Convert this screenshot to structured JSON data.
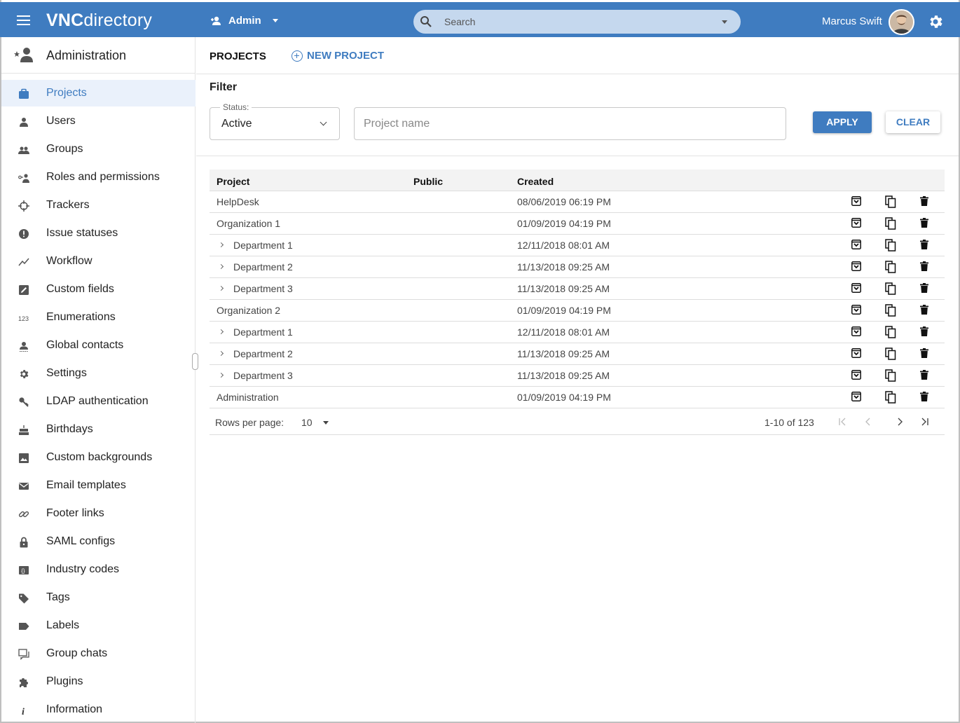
{
  "topbar": {
    "logo_bold": "VNC",
    "logo_rest": "directory",
    "mode_label": "Admin",
    "search_placeholder": "Search",
    "user_name": "Marcus Swift",
    "accent": "#3f7cc0"
  },
  "sidebar": {
    "title": "Administration",
    "items": [
      {
        "label": "Projects",
        "icon": "briefcase-icon",
        "active": true
      },
      {
        "label": "Users",
        "icon": "person-icon"
      },
      {
        "label": "Groups",
        "icon": "people-icon"
      },
      {
        "label": "Roles and permissions",
        "icon": "key-person-icon"
      },
      {
        "label": "Trackers",
        "icon": "crosshair-icon"
      },
      {
        "label": "Issue statuses",
        "icon": "alert-circle-icon"
      },
      {
        "label": "Workflow",
        "icon": "trend-line-icon"
      },
      {
        "label": "Custom fields",
        "icon": "edit-square-icon"
      },
      {
        "label": "Enumerations",
        "icon": "numbers-icon"
      },
      {
        "label": "Global contacts",
        "icon": "contact-icon"
      },
      {
        "label": "Settings",
        "icon": "gear-icon"
      },
      {
        "label": "LDAP authentication",
        "icon": "key-icon"
      },
      {
        "label": "Birthdays",
        "icon": "cake-icon"
      },
      {
        "label": "Custom backgrounds",
        "icon": "image-icon"
      },
      {
        "label": "Email templates",
        "icon": "mail-icon"
      },
      {
        "label": "Footer links",
        "icon": "link-icon"
      },
      {
        "label": "SAML configs",
        "icon": "lock-icon"
      },
      {
        "label": "Industry codes",
        "icon": "code-box-icon"
      },
      {
        "label": "Tags",
        "icon": "tag-icon"
      },
      {
        "label": "Labels",
        "icon": "label-icon"
      },
      {
        "label": "Group chats",
        "icon": "chat-icon"
      },
      {
        "label": "Plugins",
        "icon": "puzzle-icon"
      },
      {
        "label": "Information",
        "icon": "info-icon"
      }
    ]
  },
  "main": {
    "title": "PROJECTS",
    "new_project_label": "NEW PROJECT",
    "filter": {
      "title": "Filter",
      "status_label": "Status:",
      "status_value": "Active",
      "name_placeholder": "Project name",
      "apply_label": "APPLY",
      "clear_label": "CLEAR"
    },
    "table": {
      "columns": [
        "Project",
        "Public",
        "Created"
      ],
      "rows": [
        {
          "name": "HelpDesk",
          "created": "08/06/2019 06:19 PM",
          "child": false
        },
        {
          "name": "Organization 1",
          "created": "01/09/2019 04:19 PM",
          "child": false
        },
        {
          "name": "Department 1",
          "created": "12/11/2018 08:01 AM",
          "child": true
        },
        {
          "name": "Department 2",
          "created": "11/13/2018 09:25 AM",
          "child": true
        },
        {
          "name": "Department 3",
          "created": "11/13/2018 09:25 AM",
          "child": true
        },
        {
          "name": "Organization 2",
          "created": "01/09/2019 04:19 PM",
          "child": false
        },
        {
          "name": "Department 1",
          "created": "12/11/2018 08:01 AM",
          "child": true
        },
        {
          "name": "Department 2",
          "created": "11/13/2018 09:25 AM",
          "child": true
        },
        {
          "name": "Department 3",
          "created": "11/13/2018 09:25 AM",
          "child": true
        },
        {
          "name": "Administration",
          "created": "01/09/2019 04:19 PM",
          "child": false
        }
      ]
    },
    "pager": {
      "rows_per_page_label": "Rows per page:",
      "rows_per_page_value": "10",
      "range": "1-10 of 123"
    }
  }
}
